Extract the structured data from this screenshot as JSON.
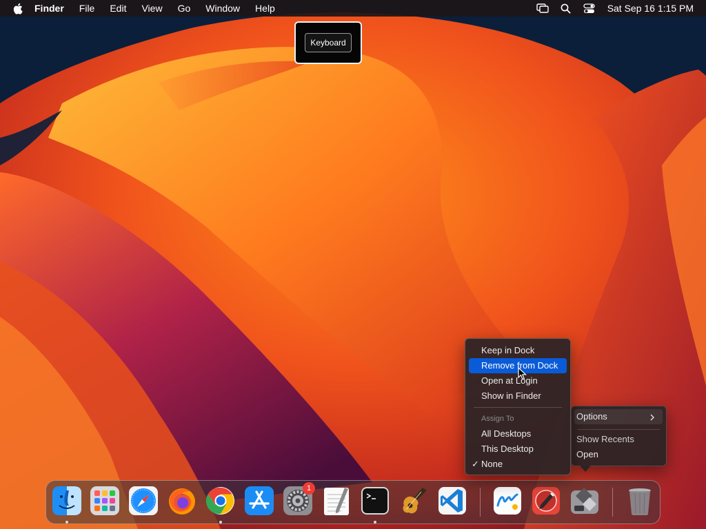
{
  "menubar": {
    "app_name": "Finder",
    "menus": [
      "File",
      "Edit",
      "View",
      "Go",
      "Window",
      "Help"
    ],
    "clock": "Sat Sep 16  1:15 PM"
  },
  "tooltip": {
    "label": "Keyboard"
  },
  "context_menu": {
    "items": [
      "Keep in Dock",
      "Remove from Dock",
      "Open at Login",
      "Show in Finder"
    ],
    "highlighted": "Remove from Dock",
    "assign_header": "Assign To",
    "assign_items": [
      "All Desktops",
      "This Desktop",
      "None"
    ],
    "checked": "None"
  },
  "submenu": {
    "options_label": "Options",
    "items": [
      "Show Recents",
      "Open"
    ]
  },
  "dock": {
    "apps": [
      "Finder",
      "Launchpad",
      "Safari",
      "Firefox",
      "Chrome",
      "App Store",
      "System Settings",
      "TextEdit",
      "Terminal",
      "GarageBand",
      "Visual Studio Code",
      "Freeform",
      "Digital Color Meter",
      "Keyboard Viewer",
      "Trash"
    ],
    "settings_badge": "1"
  },
  "colors": {
    "highlight": "#0a5bd8",
    "badge": "#ef3b34"
  }
}
